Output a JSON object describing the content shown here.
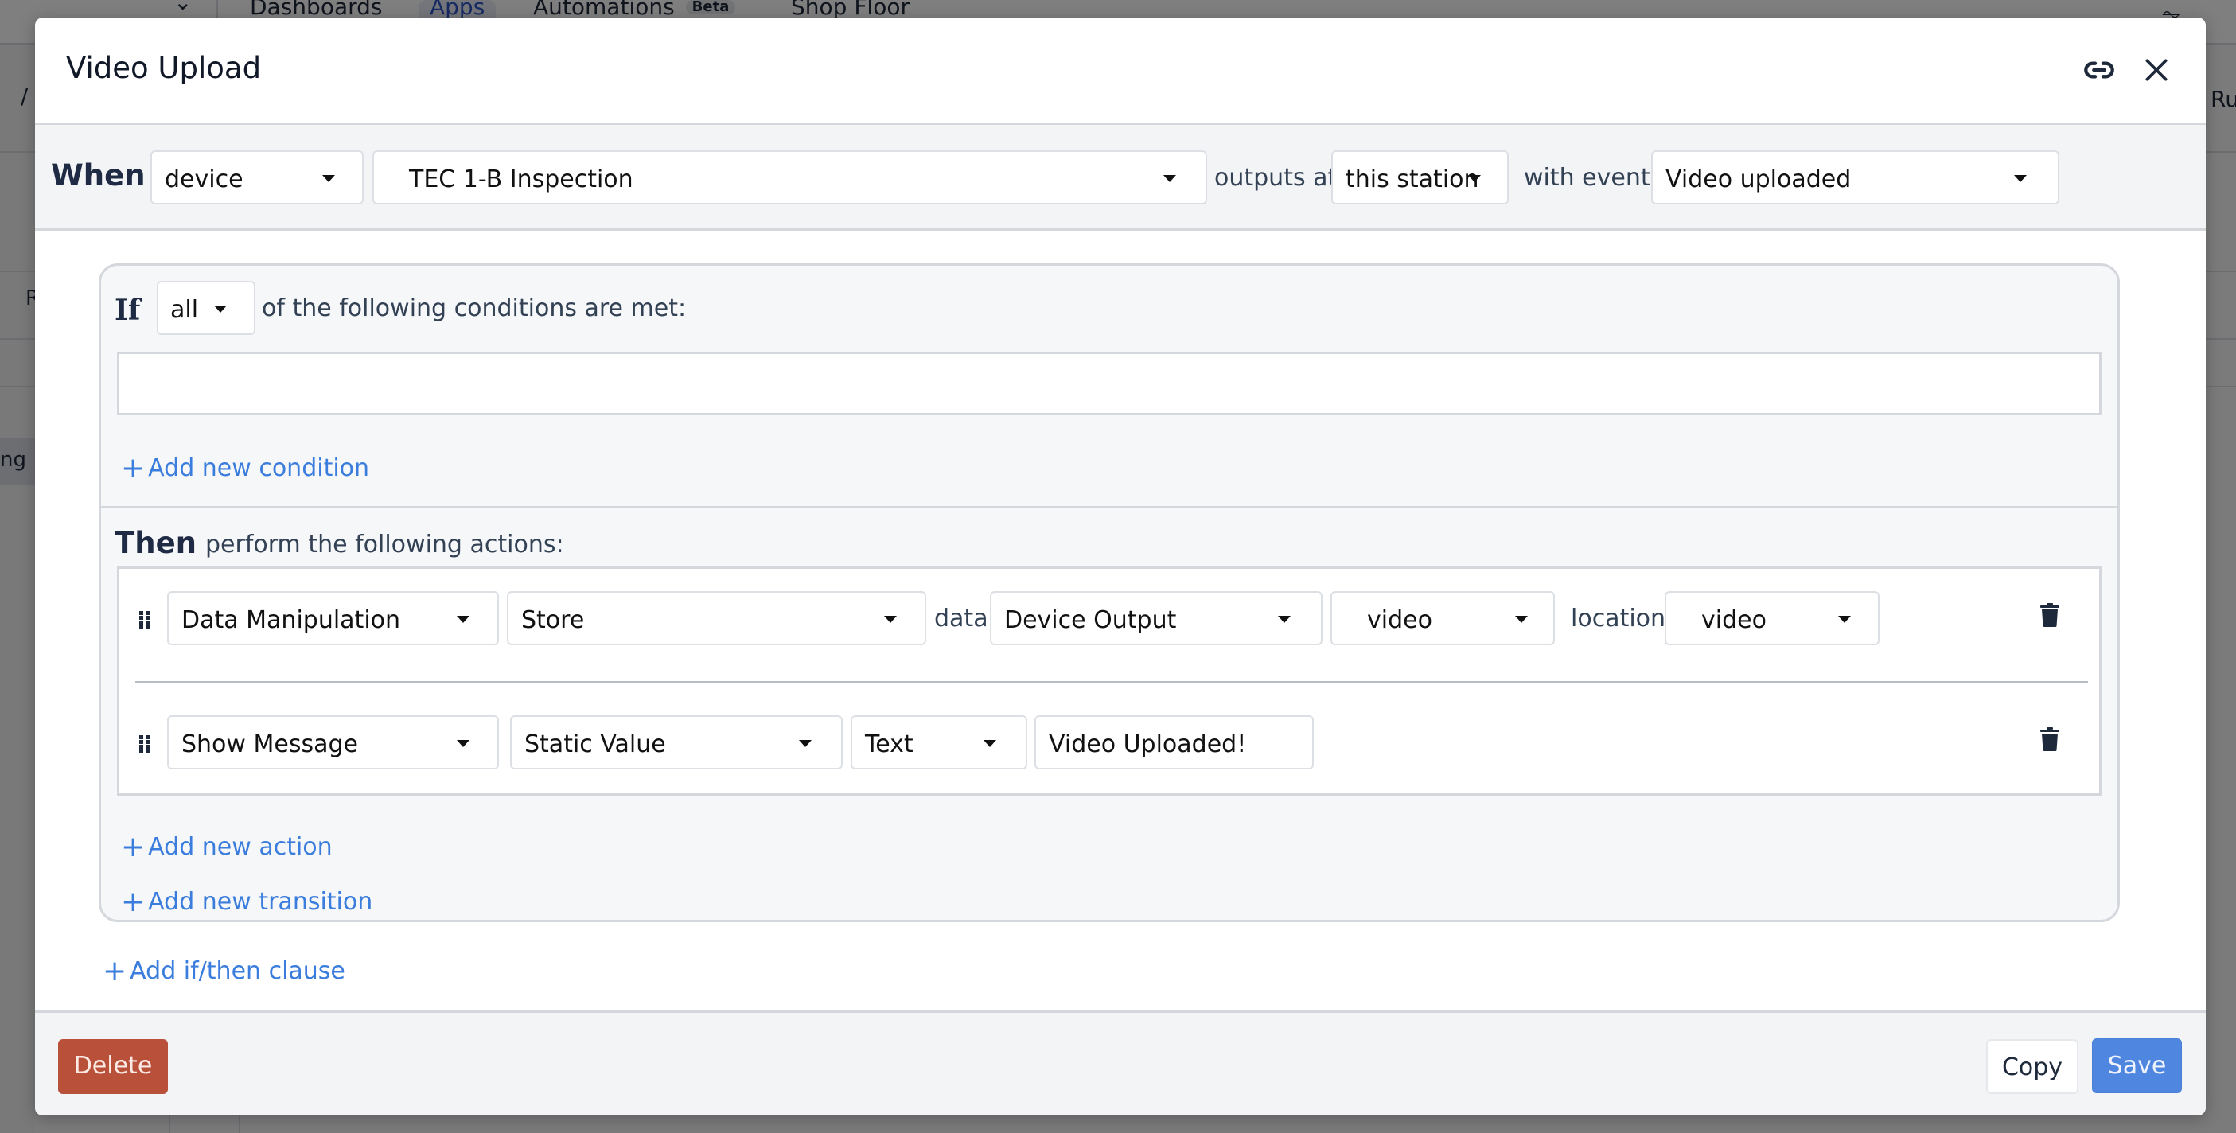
{
  "background": {
    "nav": {
      "items": [
        "Dashboards",
        "Apps",
        "Automations",
        "Shop Floor"
      ],
      "active": "Apps",
      "beta_badge": "Beta"
    },
    "fragments": {
      "left_slash": "/",
      "left_r": "R",
      "left_ng": "ng",
      "right_ru": "Ru"
    }
  },
  "modal": {
    "title": "Video Upload",
    "icons": {
      "link": "link-icon",
      "close": "close-icon"
    },
    "trigger": {
      "when_label": "When",
      "source_type": "device",
      "device": "TEC 1-B Inspection",
      "outputs_at_label": "outputs at",
      "location": "this station",
      "with_events_label": "with events",
      "event": "Video uploaded"
    },
    "clause": {
      "if_label": "If",
      "match": "all",
      "condition_text": "of the following conditions are met:",
      "add_condition": "Add new condition",
      "then_label": "Then",
      "then_text": "perform the following actions:",
      "actions": [
        {
          "type": "Data Manipulation",
          "operation": "Store",
          "data_label": "data:",
          "data_source": "Device Output",
          "data_field": "video",
          "location_label": "location:",
          "location": "video"
        },
        {
          "type": "Show Message",
          "value_type": "Static Value",
          "format": "Text",
          "message": "Video Uploaded!"
        }
      ],
      "add_action": "Add new action",
      "add_transition": "Add new transition"
    },
    "add_clause": "Add if/then clause",
    "footer": {
      "delete": "Delete",
      "copy": "Copy",
      "save": "Save"
    }
  },
  "colors": {
    "accent_link": "#3b7ddd",
    "save_button": "#4f86e0",
    "delete_button": "#b9503a",
    "keyword_text": "#1f2a44"
  }
}
